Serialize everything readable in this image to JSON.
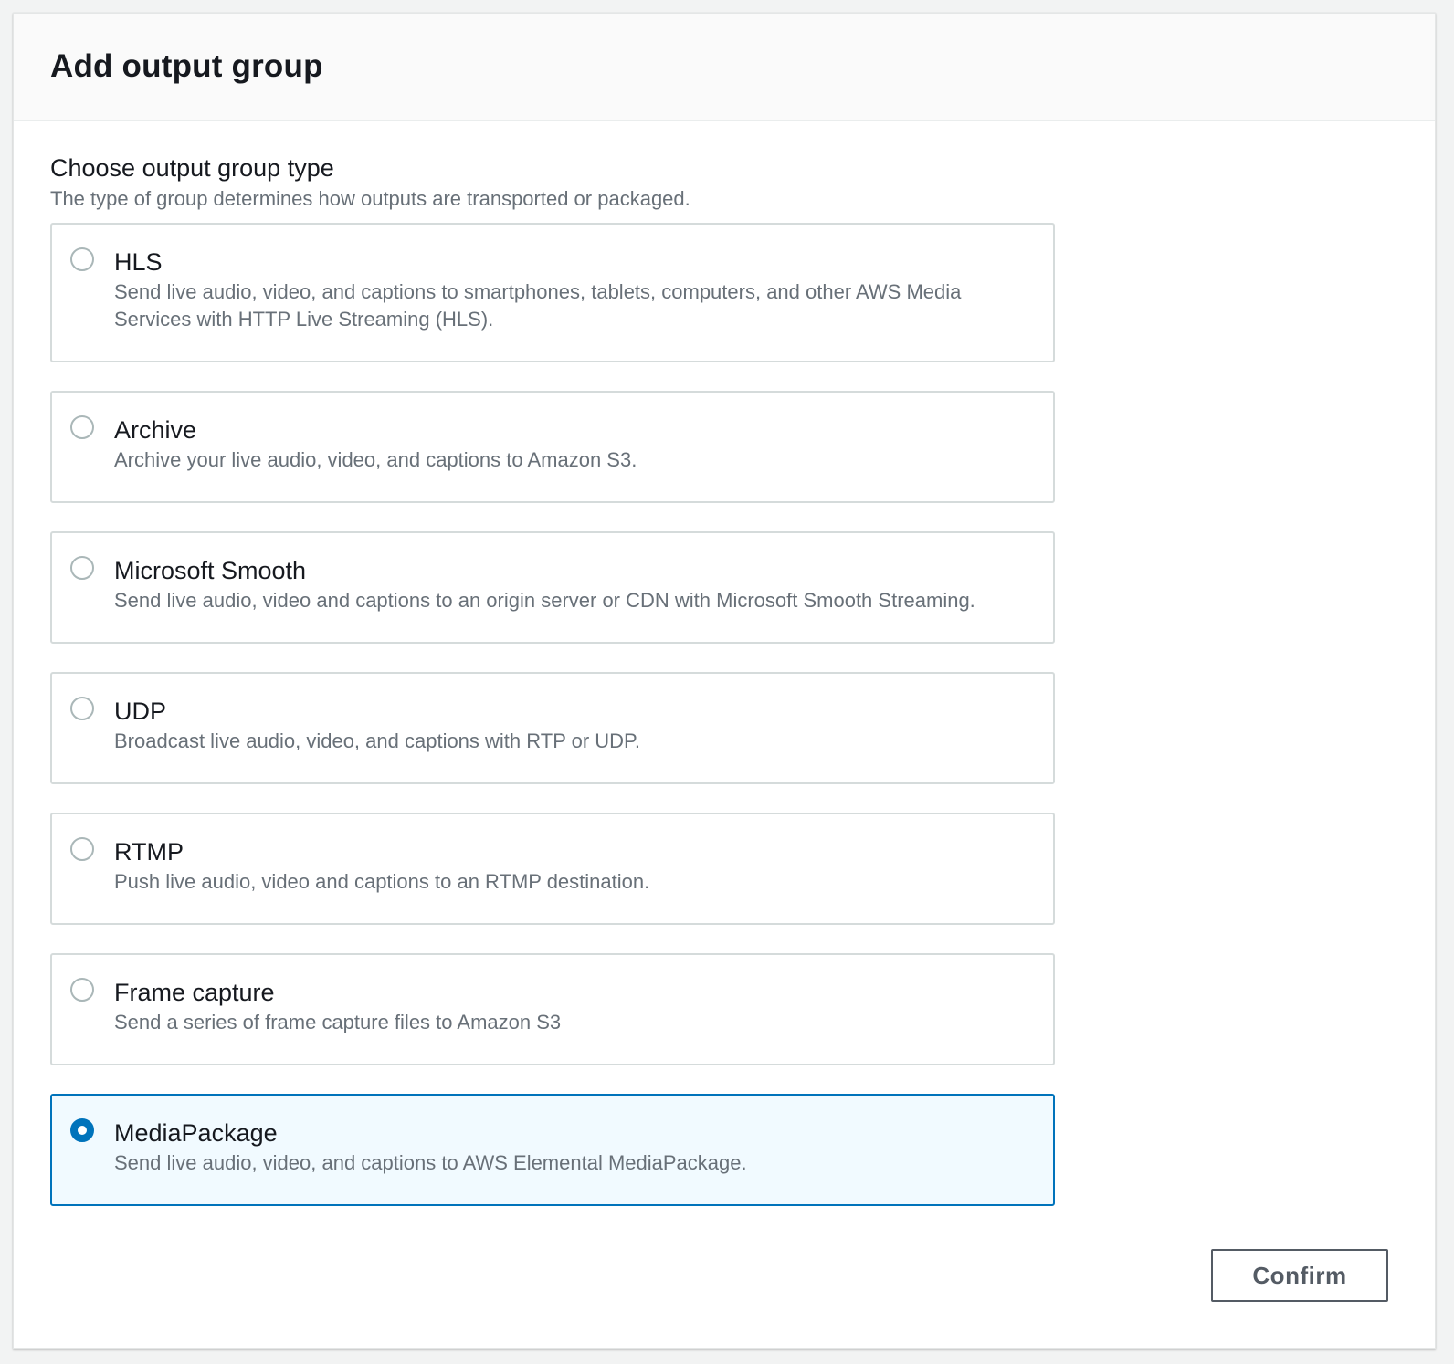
{
  "dialog": {
    "title": "Add output group"
  },
  "field": {
    "label": "Choose output group type",
    "description": "The type of group determines how outputs are transported or packaged."
  },
  "options": [
    {
      "title": "HLS",
      "description": "Send live audio, video, and captions to smartphones, tablets, computers, and other AWS Media Services with HTTP Live Streaming (HLS).",
      "selected": false
    },
    {
      "title": "Archive",
      "description": "Archive your live audio, video, and captions to Amazon S3.",
      "selected": false
    },
    {
      "title": "Microsoft Smooth",
      "description": "Send live audio, video and captions to an origin server or CDN with Microsoft Smooth Streaming.",
      "selected": false
    },
    {
      "title": "UDP",
      "description": "Broadcast live audio, video, and captions with RTP or UDP.",
      "selected": false
    },
    {
      "title": "RTMP",
      "description": "Push live audio, video and captions to an RTMP destination.",
      "selected": false
    },
    {
      "title": "Frame capture",
      "description": "Send a series of frame capture files to Amazon S3",
      "selected": false
    },
    {
      "title": "MediaPackage",
      "description": "Send live audio, video, and captions to AWS Elemental MediaPackage.",
      "selected": true
    }
  ],
  "footer": {
    "confirm_label": "Confirm"
  },
  "colors": {
    "accent": "#0073bb",
    "selected_background": "#f1faff"
  }
}
